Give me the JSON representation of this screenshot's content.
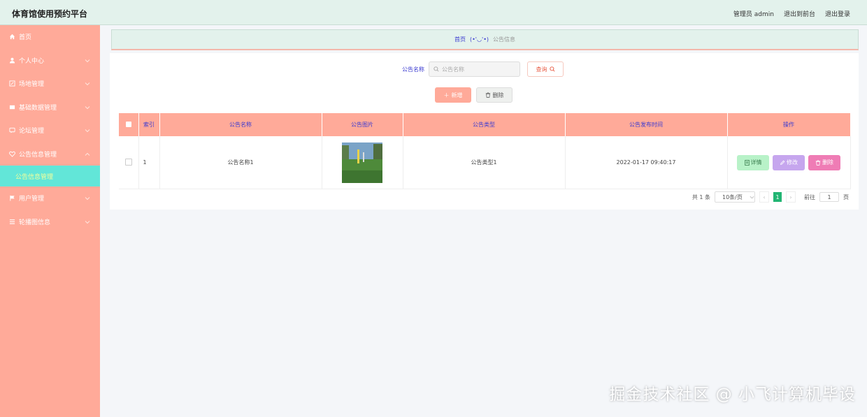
{
  "app": {
    "title": "体育馆使用预约平台"
  },
  "header": {
    "user_label": "管理员 admin",
    "to_frontend": "退出到前台",
    "logout": "退出登录"
  },
  "sidebar": {
    "items": [
      {
        "label": "首页",
        "icon": "home-icon"
      },
      {
        "label": "个人中心",
        "icon": "user-icon"
      },
      {
        "label": "场地管理",
        "icon": "venue-icon"
      },
      {
        "label": "基础数据管理",
        "icon": "database-icon"
      },
      {
        "label": "论坛管理",
        "icon": "forum-icon"
      },
      {
        "label": "公告信息管理",
        "icon": "heart-icon"
      },
      {
        "label": "用户管理",
        "icon": "flag-icon"
      },
      {
        "label": "轮播图信息",
        "icon": "list-icon"
      }
    ],
    "active_sub": "公告信息管理"
  },
  "breadcrumb": {
    "home": "首页",
    "face": "(•'◡'•)",
    "current": "公告信息"
  },
  "search": {
    "label": "公告名称",
    "placeholder": "公告名称",
    "button": "查询"
  },
  "actions": {
    "add": "新增",
    "delete": "删除"
  },
  "table": {
    "headers": [
      "索引",
      "公告名称",
      "公告图片",
      "公告类型",
      "公告发布时间",
      "操作"
    ],
    "rows": [
      {
        "index": "1",
        "name": "公告名称1",
        "type": "公告类型1",
        "time": "2022-01-17 09:40:17"
      }
    ],
    "ops": {
      "detail": "详情",
      "edit": "修改",
      "delete": "删除"
    }
  },
  "pager": {
    "total": "共 1 条",
    "size": "10条/页",
    "current": "1",
    "goto": "前往",
    "goto_value": "1",
    "page_unit": "页"
  },
  "watermark": "掘金技术社区 @ 小飞计算机毕设",
  "colors": {
    "sidebar": "#ffaa99",
    "header": "#e3f2ec",
    "active_sub": "#62e6d8",
    "accent_text": "#3a3ad0"
  }
}
